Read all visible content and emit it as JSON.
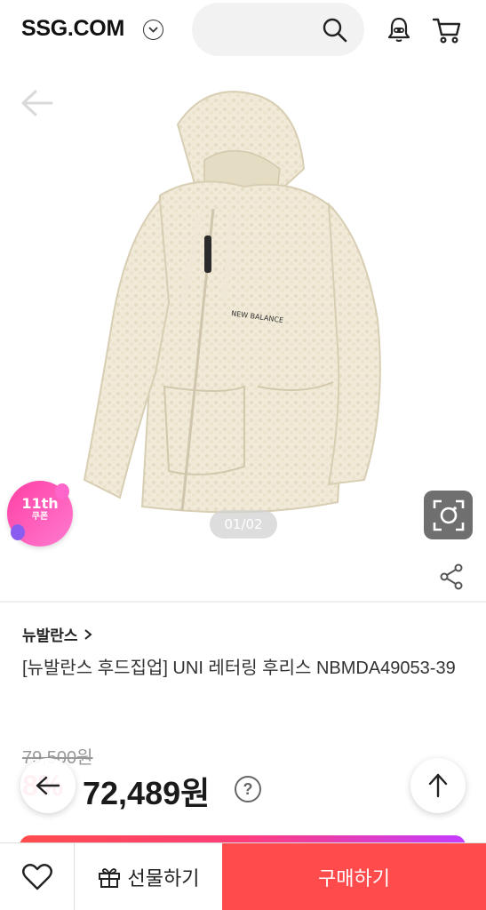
{
  "header": {
    "logo": "SSG.COM",
    "search_placeholder": ""
  },
  "gallery": {
    "pager": "01/02",
    "coupon_big": "11th",
    "coupon_small": "쿠폰",
    "jacket_print": "NEW BALANCE"
  },
  "product": {
    "brand": "뉴발란스",
    "title": "[뉴발란스 후드집업] UNI 레터링 후리스 NBMDA49053-39",
    "original_price": "79,500원",
    "discount": "8%",
    "price": "72,489원",
    "help": "?"
  },
  "bottom_bar": {
    "gift_label": "선물하기",
    "buy_label": "구매하기"
  },
  "colors": {
    "buy": "#ff4b4b",
    "discount": "#ff4e6c",
    "coupon": "#ff3fa4"
  }
}
